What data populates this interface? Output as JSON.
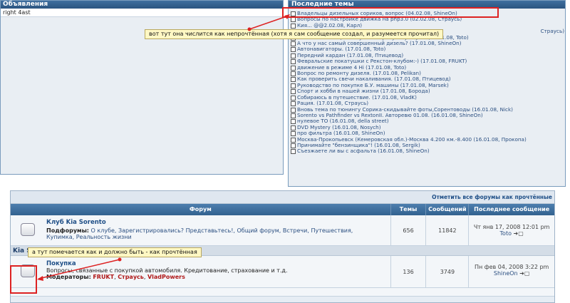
{
  "announcements": {
    "title": "Объявления",
    "text": "right 4ast"
  },
  "latest_topics": {
    "title": "Последние темы",
    "items": [
      "Владельцы дизельных сориков, вопрос (04.02.08, ShineOn)",
      "Вопросы по настройке движка на php3.0 (02.02.08, Страусь)",
      "",
      "",
      "Список желающих получить атрибутику клуба. (17.01.08, Toto)",
      "А что у нас самый совершенный дизель? (17.01.08, ShineOn)",
      "Автонавигаторы. (17.01.08, Toto)",
      "Передний кардан (17.01.08, Птицевод)",
      "Февральские покатушки с Рекстон-клубом:-) (17.01.08, FRUKT)",
      "движение в режиме 4 Hi (17.01.08, Toto)",
      "Вопрос по ремонту дизеля. (17.01.08, Pelikan)",
      "Как проверить свечи накаливания. (17.01.08, Птицевод)",
      "Руководство по покупке Б.У. машины (17.01.08, Marsek)",
      "Спорт и хобби в нашей жизни (17.01.08, Борода)",
      "Собираюсь в путешествие. (17.01.08, VladK)",
      "Рация. (17.01.08, Страусь)",
      "Вновь тема по тюнингу Сорика-скидывайте фоты,Сорентоводы (16.01.08, Nick)",
      "Sorento vs Pathfinder vs RextonII. Авторевю 01.08. (16.01.08, ShineOn)",
      "нулевое ТО (16.01.08, della street)",
      "DVD Mystery (16.01.08, Nosych)",
      "про фильтра (16.01.08, ShineOn)",
      "Москва-Прокопьевск (Кемеровская обл.)-Москва 4.200 км.-8.400 (16.01.08, Прокопа)",
      "Принимайте \"бензинщика\"! (16.01.08, Sergik)",
      "Съезжаете ли вы с асфальта (16.01.08, ShineOn)"
    ],
    "partial_fragment_3": "Кия... @@2.02.08, Карл)",
    "partial_fragment_4": "Страусь)"
  },
  "callout_top": "вот тут она числится как непрочтённая (хотя я сам сообщение создал, и разумеется прочитал)",
  "callout_bottom": "а тут помечается как и должно быть - как прочтённая",
  "forum": {
    "mark_all_read": "Отметить все форумы как прочтённые",
    "columns": [
      "Форум",
      "Темы",
      "Сообщений",
      "Последнее сообщение"
    ],
    "club": {
      "title": "Клуб Kia Sorento",
      "subforums_label": "Подфорумы:",
      "subforums": "О клубе, Зарегистрировались? Представьтесь!, Общий форум, Встречи, Путешествия,",
      "subforums_line2": "Купимка, Реальность жизни",
      "topics": "656",
      "posts": "11842",
      "last_date": "Чт янв 17, 2008 12:01 pm",
      "last_user": "Toto"
    },
    "category": "Kia Sorento",
    "buy": {
      "title": "Покупка",
      "description": "Вопросы, связанные с покупкой автомобиля. Кредитование, страхование и т.д.",
      "moderators_label": "Модераторы:",
      "moderators": [
        "FRUKT",
        "Страусь",
        "VladPowers"
      ],
      "topics": "136",
      "posts": "3749",
      "last_date": "Пн фев 04, 2008 3:22 pm",
      "last_user": "ShineOn"
    }
  }
}
